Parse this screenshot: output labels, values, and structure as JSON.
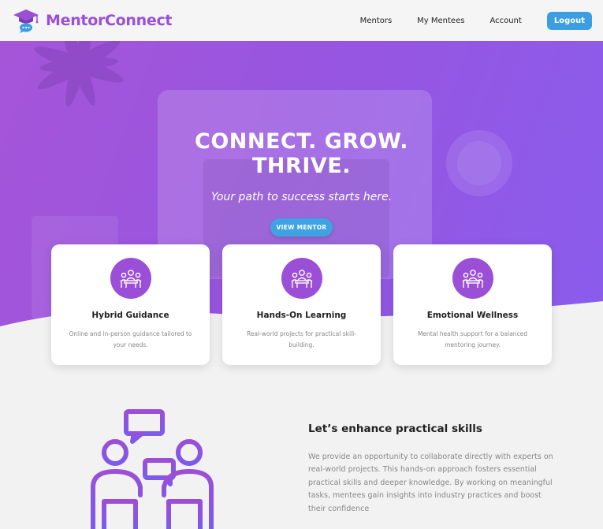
{
  "brand": {
    "name": "MentorConnect",
    "logo_icon": "graduation-cap-chat-icon",
    "accent": "#9b4fd6"
  },
  "nav": {
    "links": [
      "Mentors",
      "My Mentees",
      "Account"
    ],
    "logout_label": "Logout",
    "logout_color": "#3a9ee0"
  },
  "hero": {
    "title_line1": "CONNECT. GROW.",
    "title_line2": "THRIVE.",
    "subtitle": "Your path to success starts here.",
    "button_label": "VIEW MENTOR",
    "gradient": [
      "#a555d8",
      "#8a5cec"
    ]
  },
  "features": [
    {
      "icon": "meeting-people-icon",
      "title": "Hybrid Guidance",
      "desc": "Online and in-person guidance tailored to your needs."
    },
    {
      "icon": "meeting-people-icon",
      "title": "Hands-On Learning",
      "desc": "Real-world projects for practical skill-building."
    },
    {
      "icon": "meeting-people-icon",
      "title": "Emotional Wellness",
      "desc": "Mental health support for a balanced mentoring journey."
    }
  ],
  "skills": {
    "illustration": "mentor-mentee-chat-icon",
    "title": "Let’s enhance practical skills",
    "text": "We provide an opportunity to collaborate directly with experts on real-world projects. This hands-on approach fosters essential practical skills and deeper knowledge. By working on meaningful tasks, mentees gain insights into industry practices and boost their confidence"
  }
}
